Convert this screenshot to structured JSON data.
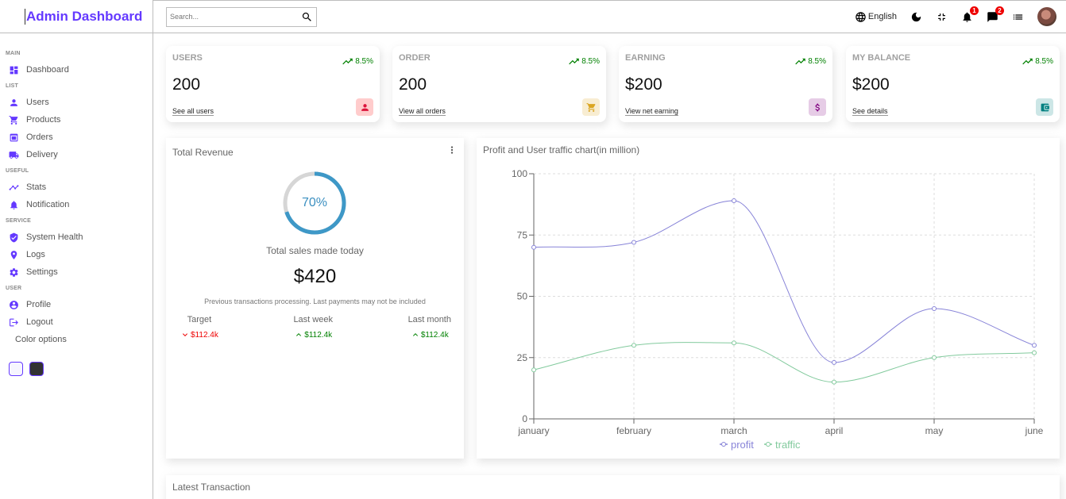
{
  "brand": {
    "title": "Admin Dashboard"
  },
  "sidebar": {
    "sections": [
      {
        "title": "MAIN",
        "items": [
          {
            "label": "Dashboard",
            "icon": "dashboard-icon"
          }
        ]
      },
      {
        "title": "LIST",
        "items": [
          {
            "label": "Users",
            "icon": "user-icon"
          },
          {
            "label": "Products",
            "icon": "cart-icon"
          },
          {
            "label": "Orders",
            "icon": "orders-icon"
          },
          {
            "label": "Delivery",
            "icon": "delivery-icon"
          }
        ]
      },
      {
        "title": "USEFUL",
        "items": [
          {
            "label": "Stats",
            "icon": "stats-icon"
          },
          {
            "label": "Notification",
            "icon": "bell-icon"
          }
        ]
      },
      {
        "title": "SERVICE",
        "items": [
          {
            "label": "System Health",
            "icon": "shield-icon"
          },
          {
            "label": "Logs",
            "icon": "logs-icon"
          },
          {
            "label": "Settings",
            "icon": "gear-icon"
          }
        ]
      },
      {
        "title": "USER",
        "items": [
          {
            "label": "Profile",
            "icon": "profile-icon"
          },
          {
            "label": "Logout",
            "icon": "logout-icon"
          }
        ]
      }
    ],
    "color_options_label": "Color options",
    "color_options": [
      "#f6f5ff",
      "#333333"
    ]
  },
  "topbar": {
    "search_placeholder": "Search...",
    "language": "English",
    "notifications_count": "1",
    "messages_count": "2"
  },
  "widgets": [
    {
      "title": "USERS",
      "percent": "8.5%",
      "count": "200",
      "link": "See all users",
      "icon": "person-icon",
      "icon_color": "#dc143c",
      "icon_bg": "rgba(255,0,0,0.2)"
    },
    {
      "title": "ORDER",
      "percent": "8.5%",
      "count": "200",
      "link": "View all orders",
      "icon": "shopping-cart-icon",
      "icon_color": "#daa520",
      "icon_bg": "rgba(218,165,32,0.2)"
    },
    {
      "title": "EARNING",
      "percent": "8.5%",
      "count": "$200",
      "link": "View net earning",
      "icon": "dollar-icon",
      "icon_color": "#800080",
      "icon_bg": "rgba(128,0,128,0.2)"
    },
    {
      "title": "MY BALANCE",
      "percent": "8.5%",
      "count": "$200",
      "link": "See details",
      "icon": "wallet-icon",
      "icon_color": "#008080",
      "icon_bg": "rgba(0,128,128,0.2)"
    }
  ],
  "featured": {
    "title": "Total Revenue",
    "progress_value": 70,
    "progress_text": "70%",
    "subtitle": "Total sales made today",
    "amount": "$420",
    "description": "Previous transactions processing. Last payments may not be included",
    "summary": [
      {
        "title": "Target",
        "value": "$112.4k",
        "trend": "down"
      },
      {
        "title": "Last week",
        "value": "$112.4k",
        "trend": "up"
      },
      {
        "title": "Last month",
        "value": "$112.4k",
        "trend": "up"
      }
    ]
  },
  "chart_data": {
    "type": "line",
    "title": "Profit and User traffic chart(in million)",
    "categories": [
      "january",
      "february",
      "march",
      "april",
      "may",
      "june"
    ],
    "series": [
      {
        "name": "profit",
        "values": [
          70,
          72,
          89,
          23,
          45,
          30
        ],
        "color": "#8884d8"
      },
      {
        "name": "traffic",
        "values": [
          20,
          30,
          31,
          15,
          25,
          27
        ],
        "color": "#82ca9d"
      }
    ],
    "ylim": [
      0,
      100
    ],
    "yticks": [
      0,
      25,
      50,
      75,
      100
    ],
    "grid": true,
    "legend": "bottom-center"
  },
  "latest": {
    "title": "Latest Transaction"
  }
}
